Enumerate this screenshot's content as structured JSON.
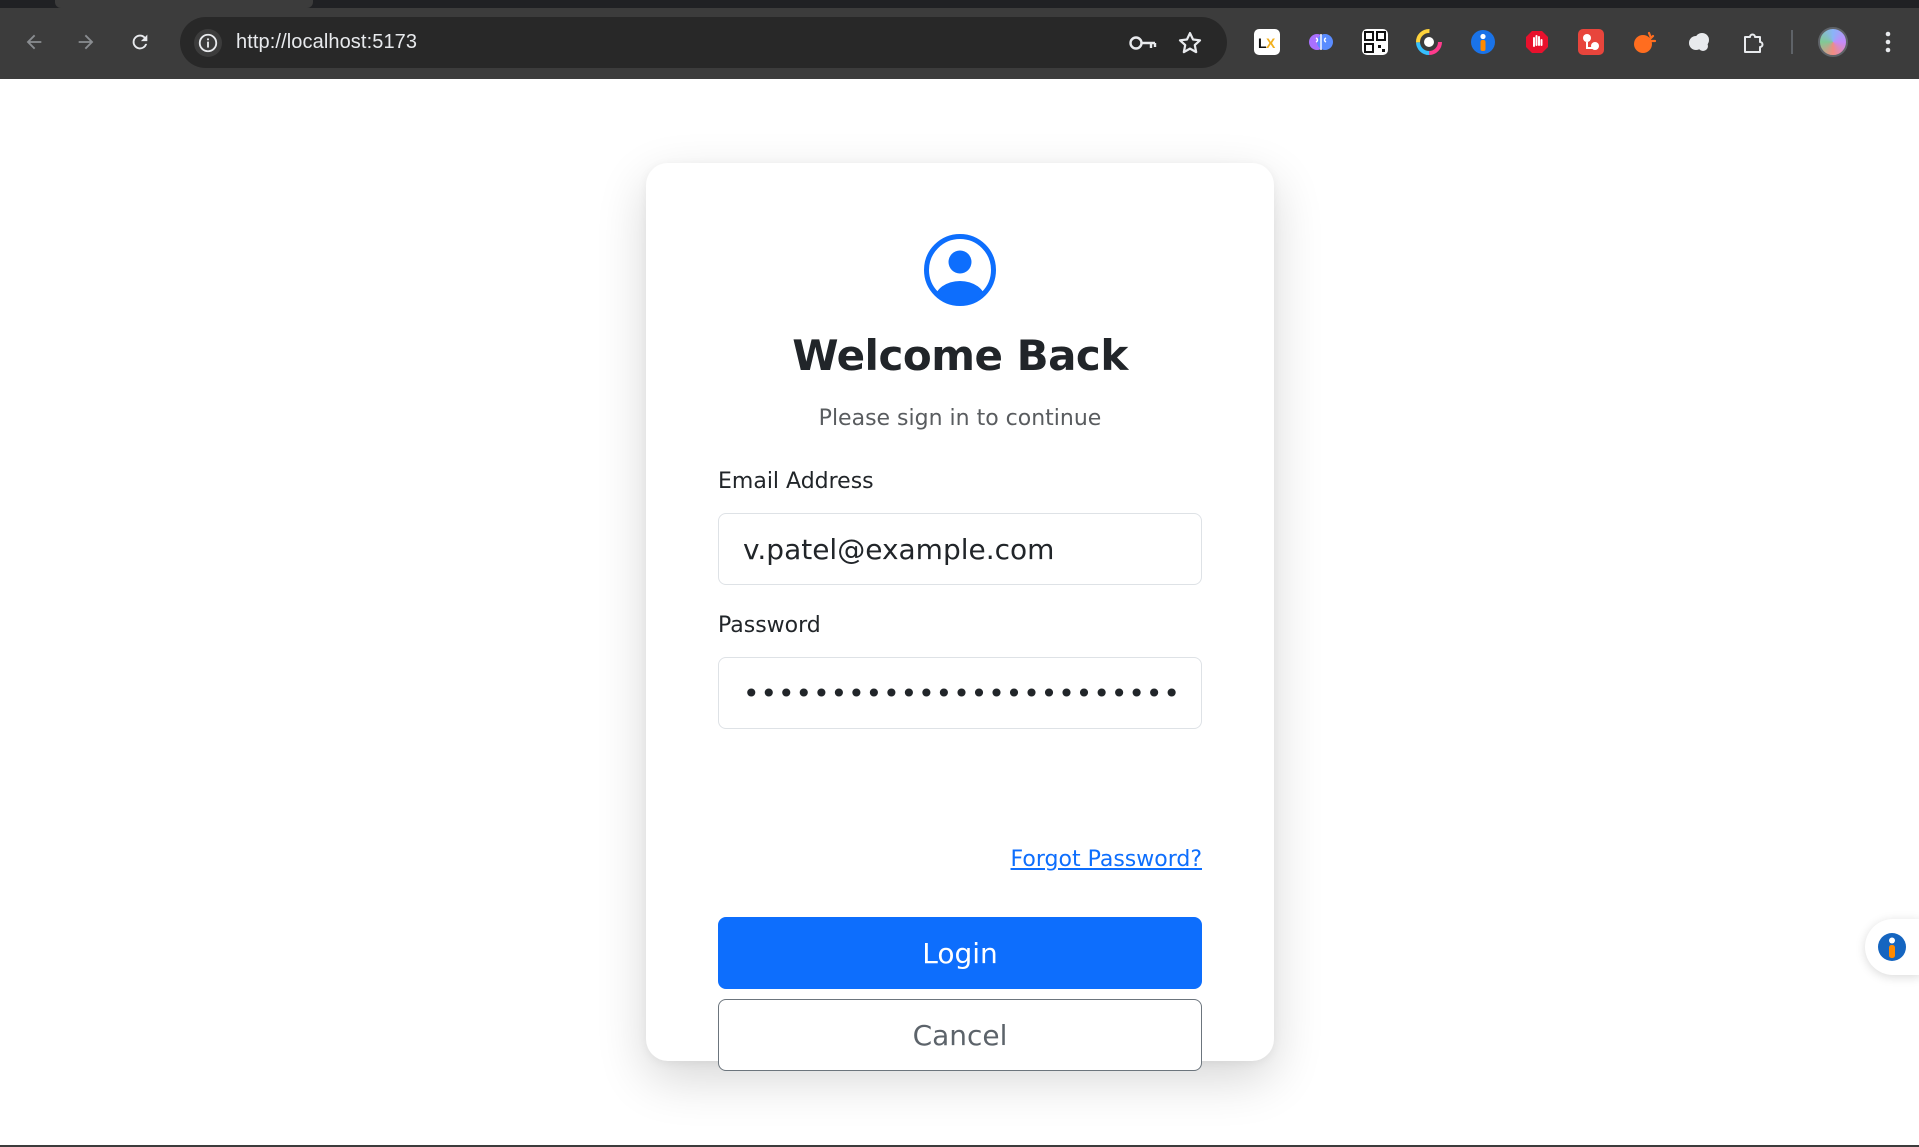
{
  "browser": {
    "url": "http://localhost:5173",
    "icons": {
      "back": "arrow-left-icon",
      "forward": "arrow-right-icon",
      "reload": "reload-icon",
      "site_info": "info-icon",
      "password_key": "key-icon",
      "bookmark": "star-icon",
      "extensions": "puzzle-icon",
      "menu": "more-vert-icon"
    },
    "extensions": [
      "lx-extension-icon",
      "brain-extension-icon",
      "qr-extension-icon",
      "color-ring-extension-icon",
      "accessibility-extension-icon",
      "stop-hand-extension-icon",
      "red-puzzle-extension-icon",
      "orange-burst-extension-icon",
      "cloud-extension-icon"
    ]
  },
  "login": {
    "title": "Welcome Back",
    "subtitle": "Please sign in to continue",
    "email_label": "Email Address",
    "email_value": "v.patel@example.com",
    "password_label": "Password",
    "password_value": "•••••••••••••••••••••••••",
    "forgot_password": "Forgot Password?",
    "login_button": "Login",
    "cancel_button": "Cancel"
  },
  "colors": {
    "primary": "#0d6efd",
    "chrome_bg": "#3c3c3c",
    "omnibox_bg": "#282828",
    "text_dark": "#212529",
    "text_muted": "#595c5f"
  }
}
